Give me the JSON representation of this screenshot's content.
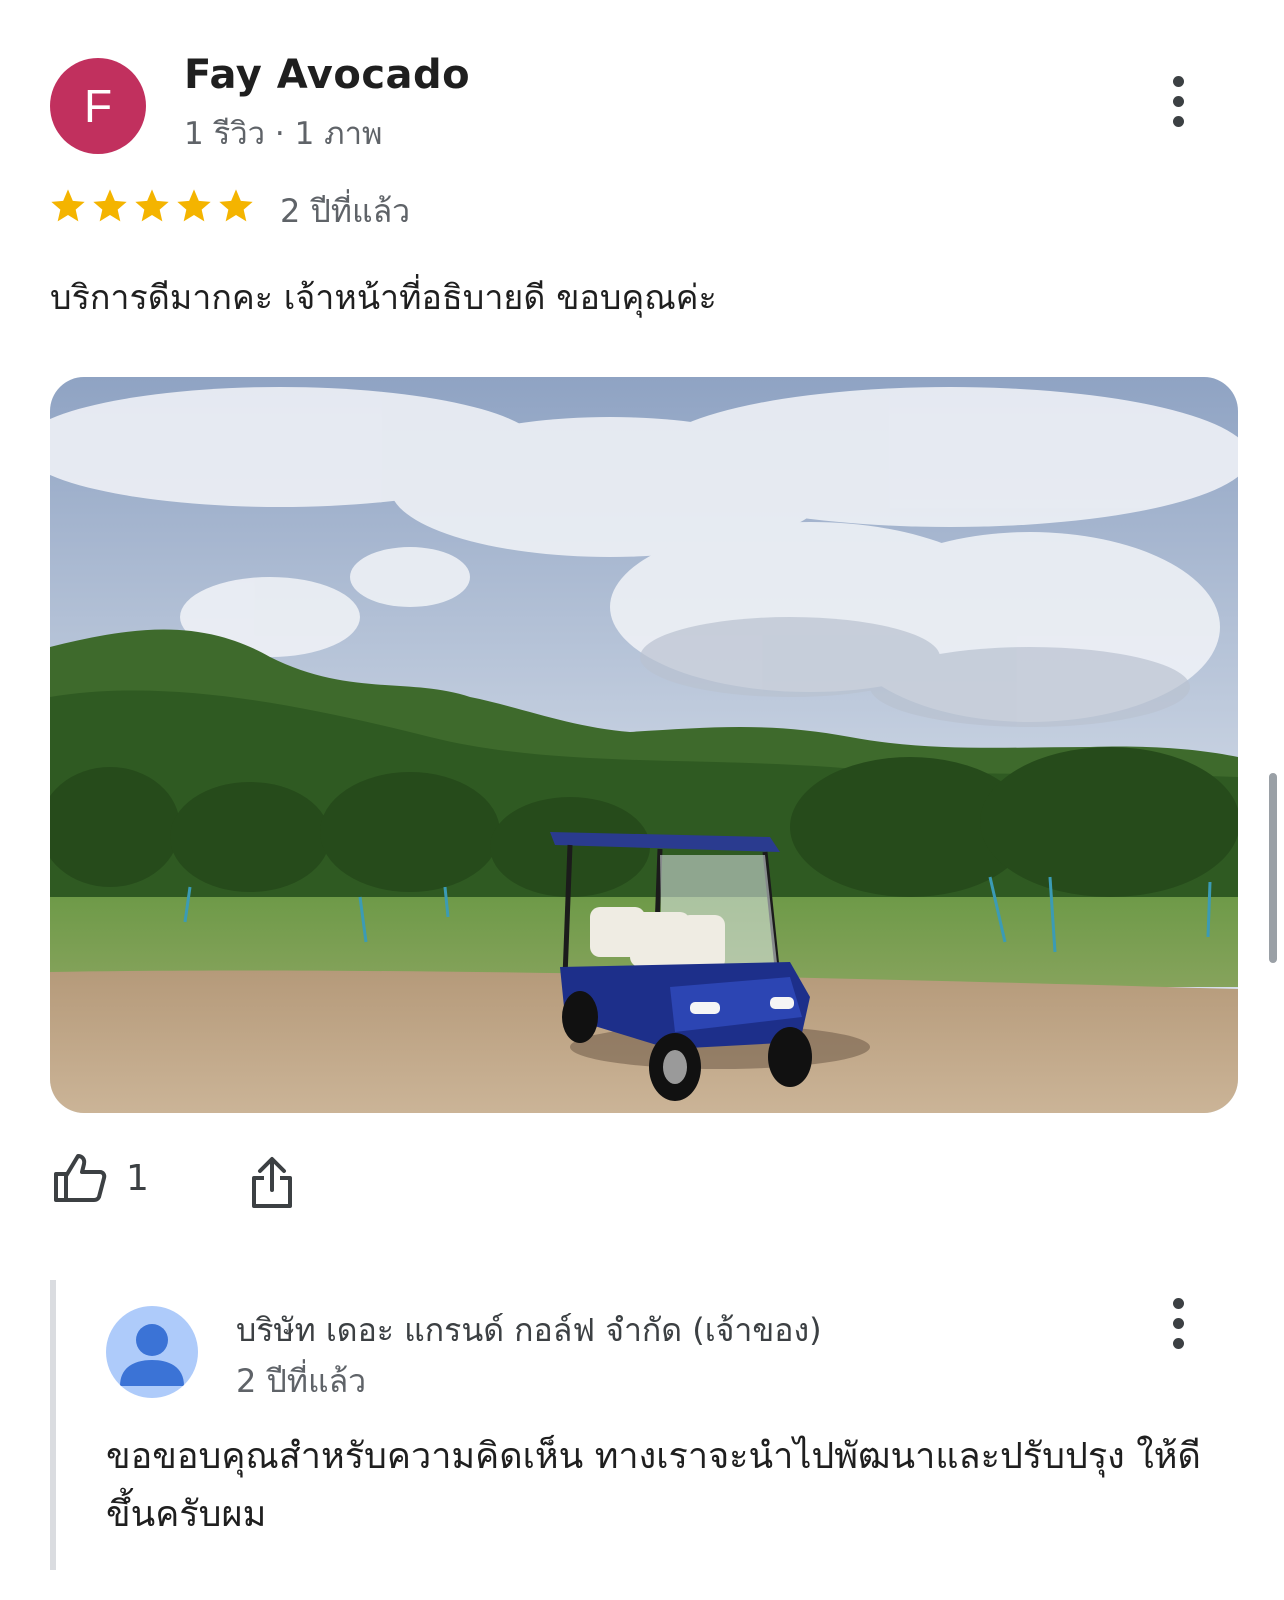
{
  "review": {
    "avatar_letter": "F",
    "avatar_color": "#c1305e",
    "reviewer_name": "Fay Avocado",
    "reviewer_meta": "1 รีวิว · 1 ภาพ",
    "rating": 5,
    "star_color": "#f4b400",
    "time": "2 ปีที่แล้ว",
    "text": "บริการดีมากคะ เจ้าหน้าที่อธิบายดี ขอบคุณค่ะ",
    "photo_icon": "golf-cart-landscape-photo",
    "like_icon": "thumb-up-icon",
    "like_count": "1",
    "share_icon": "share-icon",
    "more_icon": "more-vert-icon"
  },
  "owner_reply": {
    "avatar_icon": "person-icon",
    "name": "บริษัท เดอะ แกรนด์ กอล์ฟ จำกัด (เจ้าของ)",
    "time": "2 ปีที่แล้ว",
    "text": "ขอขอบคุณสำหรับความคิดเห็น ทางเราจะนำไปพัฒนาและปรับปรุง ให้ดีขึ้นครับผม",
    "more_icon": "more-vert-icon"
  }
}
